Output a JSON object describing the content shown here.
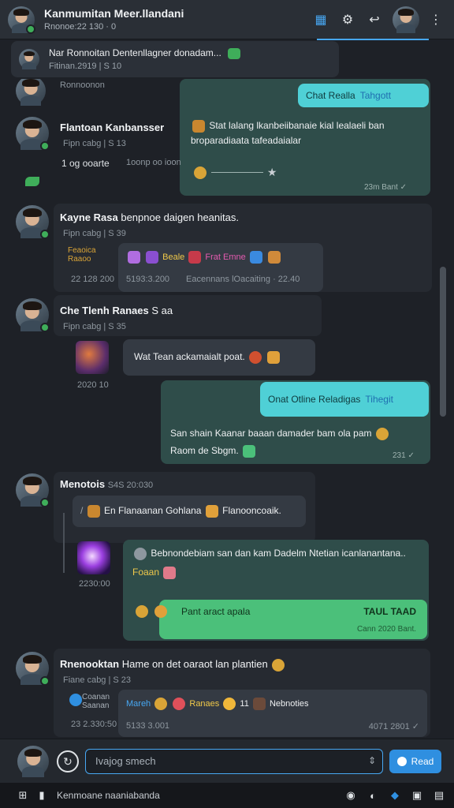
{
  "header": {
    "title": "Kanmumitan Meer.llandani",
    "subtitle": "Rnonoe:22 130 · 0"
  },
  "pinned": {
    "line1": "Nar Ronnoitan Dentenllagner donadam...",
    "line2": "Fitinan.2919 | S 10"
  },
  "messages": {
    "m0": {
      "name": "Ronnoonon"
    },
    "m1": {
      "name": "Flantoan Kanbansser",
      "sub": "Fipn cabg | S 13",
      "side_label": "1 og ooarte",
      "side_meta": "1oonp oo ioon",
      "out_cyan": "Chat Realla",
      "out_cyan_link": "Tahgott",
      "out_text": "Stat lalang lkanbeiibanaie kial lealaeli ban broparadiaata tafeadaialar",
      "out_meta": "23m Bant ✓"
    },
    "m2": {
      "name": "Kayne Rasa",
      "name_tail": "benpnoe daigen heanitas.",
      "sub": "Fipn cabg | S 39",
      "attach_top": "Feaoica",
      "attach_bot": "Raaoo",
      "attach_time": "22 128 200",
      "row1": "Beale",
      "row2": "Frat Emne",
      "meta1": "5193:3.200",
      "meta2": "Eacennans lOacaiting · 22.40"
    },
    "m3": {
      "name": "Che Tlenh Ranaes",
      "name_tail": "S aa",
      "sub": "Fipn cabg | S 35",
      "thumb_time": "2020 10",
      "in_text": "Wat Tean ackamaialt poat.",
      "out_cyan": "Onat Otline Reladigas",
      "out_cyan_link": "Tihegit",
      "out_text": "San shain Kaanar baaan damader bam ola pam",
      "out_text2": "Raom de Sbgm.",
      "out_meta": "231 ✓"
    },
    "m4": {
      "name": "Menotois",
      "name_tail": "S4S 20:030",
      "quote": "En Flanaanan Gohlana",
      "quote_tail": "Flanooncoaik.",
      "thumb_time": "2230:00",
      "in_text": "Bebnondebiam san dan kam Dadelm Ntetian icanlanantana..",
      "in_text2": "Foaan",
      "green_text": "Pant aract apala",
      "green_right": "TAUL TAAD",
      "green_meta": "Cann 2020 Bant."
    },
    "m5": {
      "name": "Rnenooktan",
      "name_tail": "Hame on det oaraot lan plantien",
      "sub": "Fiane cabg | S 23",
      "attach_top": "Coanan",
      "attach_bot": "Saanan",
      "attach_time": "23 2.330:50",
      "row_a": "Mareh",
      "row_b": "Ranaes",
      "row_c": "11",
      "row_d": "Nebnoties",
      "meta1": "5133 3.001",
      "meta2": "4071 2801 ✓"
    }
  },
  "composer": {
    "placeholder": "Ivajog smech",
    "send_label": "Read"
  },
  "taskbar": {
    "label": "Kenmoane naaniabanda"
  },
  "colors": {
    "accent": "#47a7f2",
    "online": "#3fae5a",
    "teal_bubble": "#2f4d4a",
    "cyan_bubble": "#4fd0d6",
    "green_bubble": "#4bc07a"
  },
  "icons": {
    "header": [
      "grid-icon",
      "gear-alert-icon",
      "reply-icon",
      "more-vertical-icon"
    ],
    "composer": [
      "refresh-icon",
      "send-icon"
    ],
    "taskbar": [
      "windows-icon",
      "app-icon",
      "browser-icon",
      "edge-icon",
      "security-icon",
      "notes-icon"
    ]
  }
}
